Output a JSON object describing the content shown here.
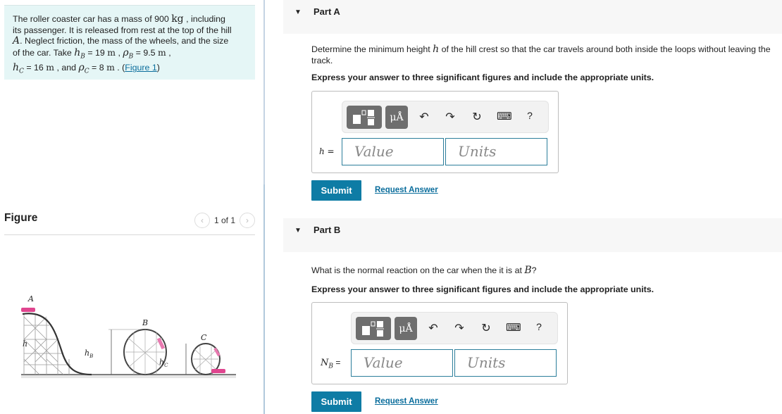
{
  "problem": {
    "line1_pre": "The roller coaster car has a mass of 900 ",
    "line1_unit": "kg",
    "line1_post": " , including",
    "line2": "its passenger. It is released from rest at the top of the hill",
    "line3_var": "A",
    "line3_post": ". Neglect friction, the mass of the wheels, and the size",
    "line4_pre": "of the car. Take ",
    "hB_label": "h",
    "hB_sub": "B",
    "hB_value": " = 19 ",
    "rhoB_label": "ρ",
    "rhoB_sub": "B",
    "rhoB_value": " = 9.5 ",
    "hC_label": "h",
    "hC_sub": "C",
    "hC_value": " = 16 ",
    "and": " , and ",
    "rhoC_label": "ρ",
    "rhoC_sub": "C",
    "rhoC_value": " = 8 ",
    "unit_m": "m",
    "figure_link_pre": " . (",
    "figure_link": "Figure 1",
    "figure_link_post": ")"
  },
  "figure": {
    "title": "Figure",
    "pager": "1 of 1",
    "labels": {
      "A": "A",
      "B": "B",
      "C": "C",
      "h": "h",
      "hB": "h",
      "hB_sub": "B",
      "hC": "h",
      "hC_sub": "C"
    }
  },
  "partA": {
    "title": "Part A",
    "question_pre": "Determine the minimum height ",
    "question_var": "h",
    "question_post": " of the hill crest so that the car travels around both inside the loops without leaving the track.",
    "instruction": "Express your answer to three significant figures and include the appropriate units.",
    "answer_label": "h =",
    "value_placeholder": "Value",
    "units_placeholder": "Units",
    "submit": "Submit",
    "request": "Request Answer"
  },
  "partB": {
    "title": "Part B",
    "question_pre": "What is the normal reaction on the car when the it is at ",
    "question_var": "B",
    "question_post": "?",
    "instruction": "Express your answer to three significant figures and include the appropriate units.",
    "answer_label": "N",
    "answer_sub": "B",
    "answer_eq": " =",
    "value_placeholder": "Value",
    "units_placeholder": "Units",
    "submit": "Submit",
    "request": "Request Answer"
  },
  "toolbar": {
    "units_btn": "μÅ",
    "undo": "↶",
    "redo": "↷",
    "reset": "↻",
    "keyboard": "⌨",
    "help": "?"
  }
}
